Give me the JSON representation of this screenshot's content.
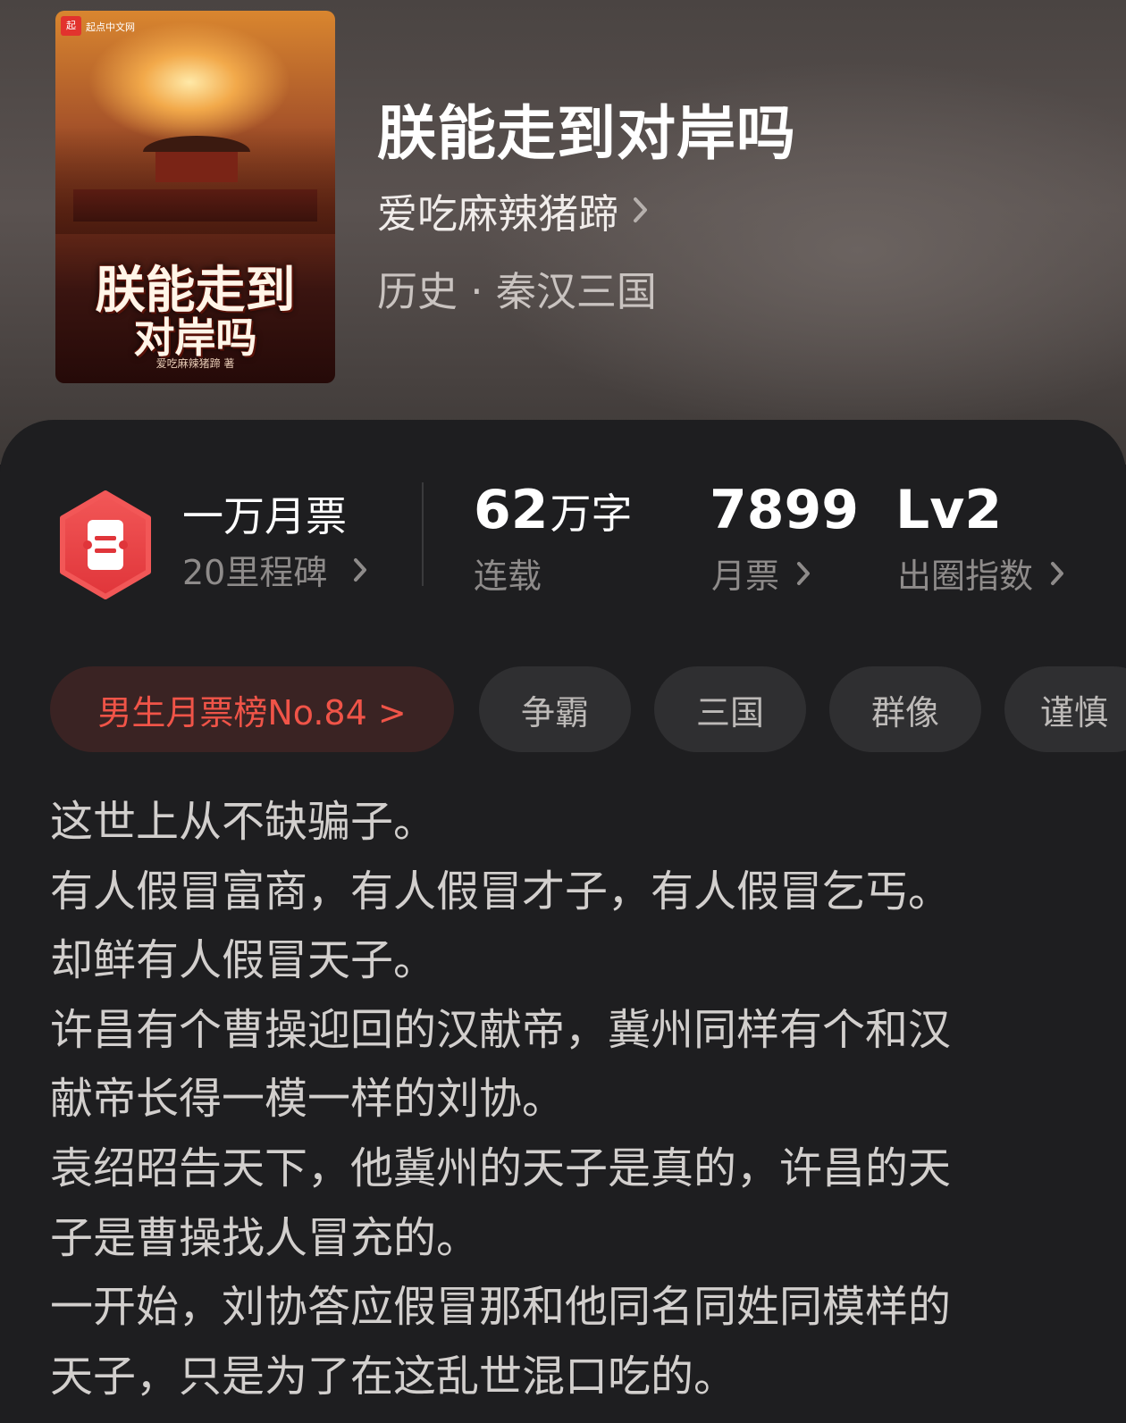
{
  "book": {
    "title": "朕能走到对岸吗",
    "author": "爱吃麻辣猪蹄",
    "genre": "历史 · 秦汉三国",
    "cover": {
      "publisher_badge": "起",
      "publisher": "起点中文网",
      "title_line1": "朕能走到",
      "title_line2": "对岸吗",
      "author": "爱吃麻辣猪蹄 著"
    }
  },
  "milestone": {
    "title": "一万月票",
    "subtitle": "20里程碑",
    "badge_color": "#f04e4e"
  },
  "stats": {
    "words_value": "62",
    "words_unit": "万字",
    "words_label": "连载",
    "tickets_value": "7899",
    "tickets_label": "月票",
    "level_value": "Lv2",
    "level_label": "出圈指数"
  },
  "tags": {
    "rank": "男生月票榜No.84 >",
    "items": [
      "争霸",
      "三国",
      "群像",
      "谨慎"
    ]
  },
  "synopsis": [
    "这世上从不缺骗子。",
    "有人假冒富商，有人假冒才子，有人假冒乞丐。",
    "却鲜有人假冒天子。",
    "许昌有个曹操迎回的汉献帝，冀州同样有个和汉",
    "献帝长得一模一样的刘协。",
    "袁绍昭告天下，他冀州的天子是真的，许昌的天",
    "子是曹操找人冒充的。",
    "一开始，刘协答应假冒那和他同名同姓同模样的",
    "天子，只是为了在这乱世混口吃的。"
  ],
  "colors": {
    "accent": "#f05448",
    "sheet_bg": "#1e1e20",
    "tag_bg": "#2f2f31",
    "rank_tag_bg": "#3a2323"
  }
}
